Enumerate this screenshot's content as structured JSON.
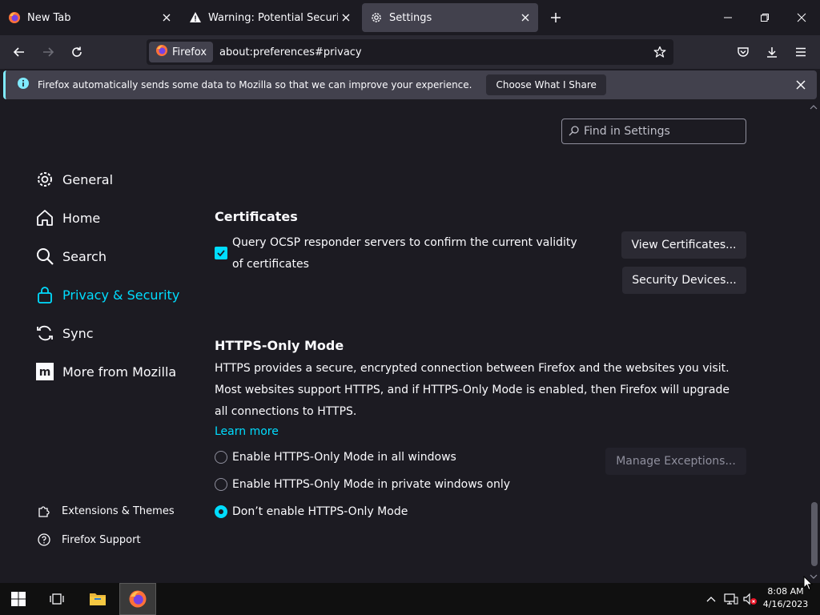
{
  "tabs": [
    {
      "label": "New Tab",
      "icon": "firefox-icon"
    },
    {
      "label": "Warning: Potential Security Risk",
      "icon": "warning-icon"
    },
    {
      "label": "Settings",
      "icon": "gear-icon",
      "active": true
    }
  ],
  "navbar": {
    "identity_label": "Firefox",
    "url": "about:preferences#privacy"
  },
  "notification": {
    "text": "Firefox automatically sends some data to Mozilla so that we can improve your experience.",
    "button_label": "Choose What I Share"
  },
  "search": {
    "placeholder": "Find in Settings"
  },
  "sidebar": {
    "items": [
      {
        "label": "General",
        "icon": "gear-icon"
      },
      {
        "label": "Home",
        "icon": "home-icon"
      },
      {
        "label": "Search",
        "icon": "search-icon"
      },
      {
        "label": "Privacy & Security",
        "icon": "lock-icon",
        "active": true
      },
      {
        "label": "Sync",
        "icon": "sync-icon"
      },
      {
        "label": "More from Mozilla",
        "icon": "mozilla-icon"
      }
    ],
    "footer": [
      {
        "label": "Extensions & Themes",
        "icon": "puzzle-icon"
      },
      {
        "label": "Firefox Support",
        "icon": "help-icon"
      }
    ]
  },
  "certificates": {
    "heading": "Certificates",
    "ocsp_label": "Query OCSP responder servers to confirm the current validity of certificates",
    "ocsp_checked": true,
    "view_button": "View Certificates...",
    "devices_button": "Security Devices..."
  },
  "https_only": {
    "heading": "HTTPS-Only Mode",
    "description": "HTTPS provides a secure, encrypted connection between Firefox and the websites you visit. Most websites support HTTPS, and if HTTPS-Only Mode is enabled, then Firefox will upgrade all connections to HTTPS.",
    "learn_more": "Learn more",
    "manage_button": "Manage Exceptions...",
    "options": [
      {
        "label": "Enable HTTPS-Only Mode in all windows",
        "selected": false
      },
      {
        "label": "Enable HTTPS-Only Mode in private windows only",
        "selected": false
      },
      {
        "label": "Don’t enable HTTPS-Only Mode",
        "selected": true
      }
    ]
  },
  "taskbar": {
    "time": "8:08 AM",
    "date": "4/16/2023"
  },
  "colors": {
    "accent": "#00ddff",
    "background": "#1c1b22",
    "surface": "#2b2a33"
  }
}
